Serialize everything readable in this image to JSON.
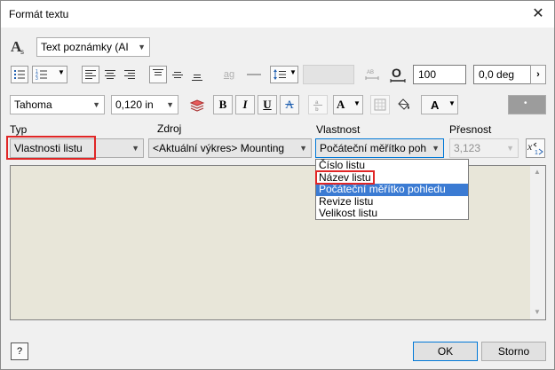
{
  "window": {
    "title": "Formát textu",
    "close_glyph": "✕"
  },
  "style_select": {
    "value": "Text poznámky (AI"
  },
  "toolbar1": {
    "line_spacing_value": "100",
    "rotation_value": "0,0 deg",
    "stack_label": "ag"
  },
  "toolbar2": {
    "font": "Tahoma",
    "size": "0,120 in",
    "bold": "B",
    "italic": "I",
    "underline": "U",
    "strike": "A",
    "case_label": "A",
    "color_label": "A"
  },
  "fields": {
    "type_label": "Typ",
    "type_value": "Vlastnosti listu",
    "source_label": "Zdroj",
    "source_value": "<Aktuální výkres> Mounting",
    "property_label": "Vlastnost",
    "property_value": "Počáteční měřítko poh",
    "precision_label": "Přesnost",
    "precision_value": "3,123"
  },
  "dropdown": {
    "items": [
      "Číslo listu",
      "Název listu",
      "Počáteční měřítko pohledu",
      "Revize listu",
      "Velikost listu"
    ],
    "selected_index": 2,
    "highlighted_index": 1
  },
  "buttons": {
    "ok": "OK",
    "cancel": "Storno",
    "help": "?"
  },
  "colors": {
    "selection": "#3b7bd3",
    "highlight_box": "#e02626",
    "editor_bg": "#e8e6d9"
  }
}
